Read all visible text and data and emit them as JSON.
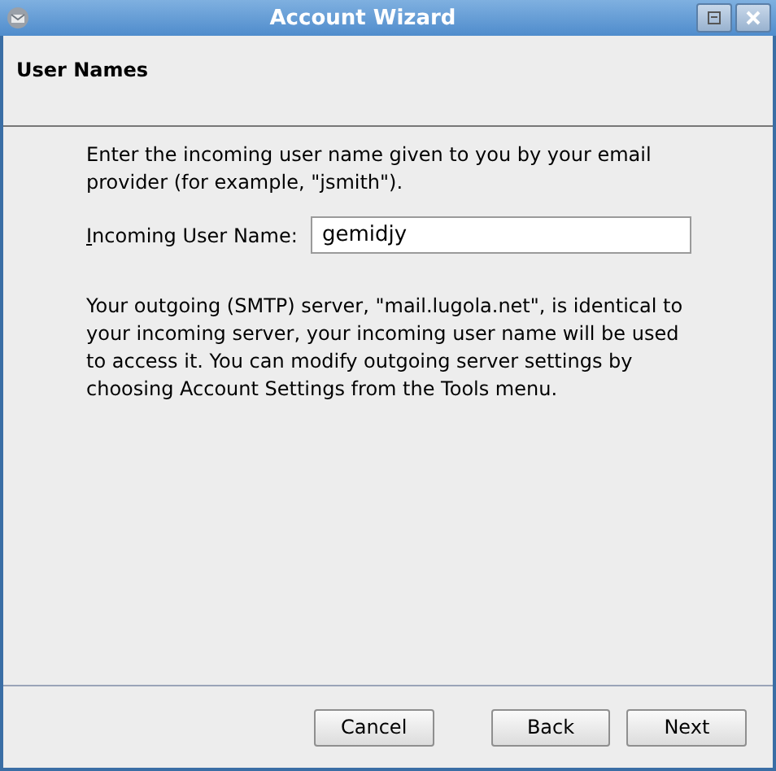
{
  "window": {
    "title": "Account Wizard"
  },
  "page": {
    "heading": "User Names",
    "intro": "Enter the incoming user name given to you by your email provider (for example, \"jsmith\").",
    "field": {
      "label": "Incoming User Name:",
      "mnemonic_underlined": true,
      "value": "gemidjy"
    },
    "note": "Your outgoing (SMTP) server, \"mail.lugola.net\", is identical to your incoming server, your incoming user name will be used to access it. You can modify outgoing server settings by choosing Account Settings from the Tools menu."
  },
  "buttons": [
    {
      "label": "Cancel",
      "kind": "cancel"
    },
    {
      "label": "Back",
      "kind": "nav"
    },
    {
      "label": "Next",
      "kind": "nav"
    }
  ]
}
